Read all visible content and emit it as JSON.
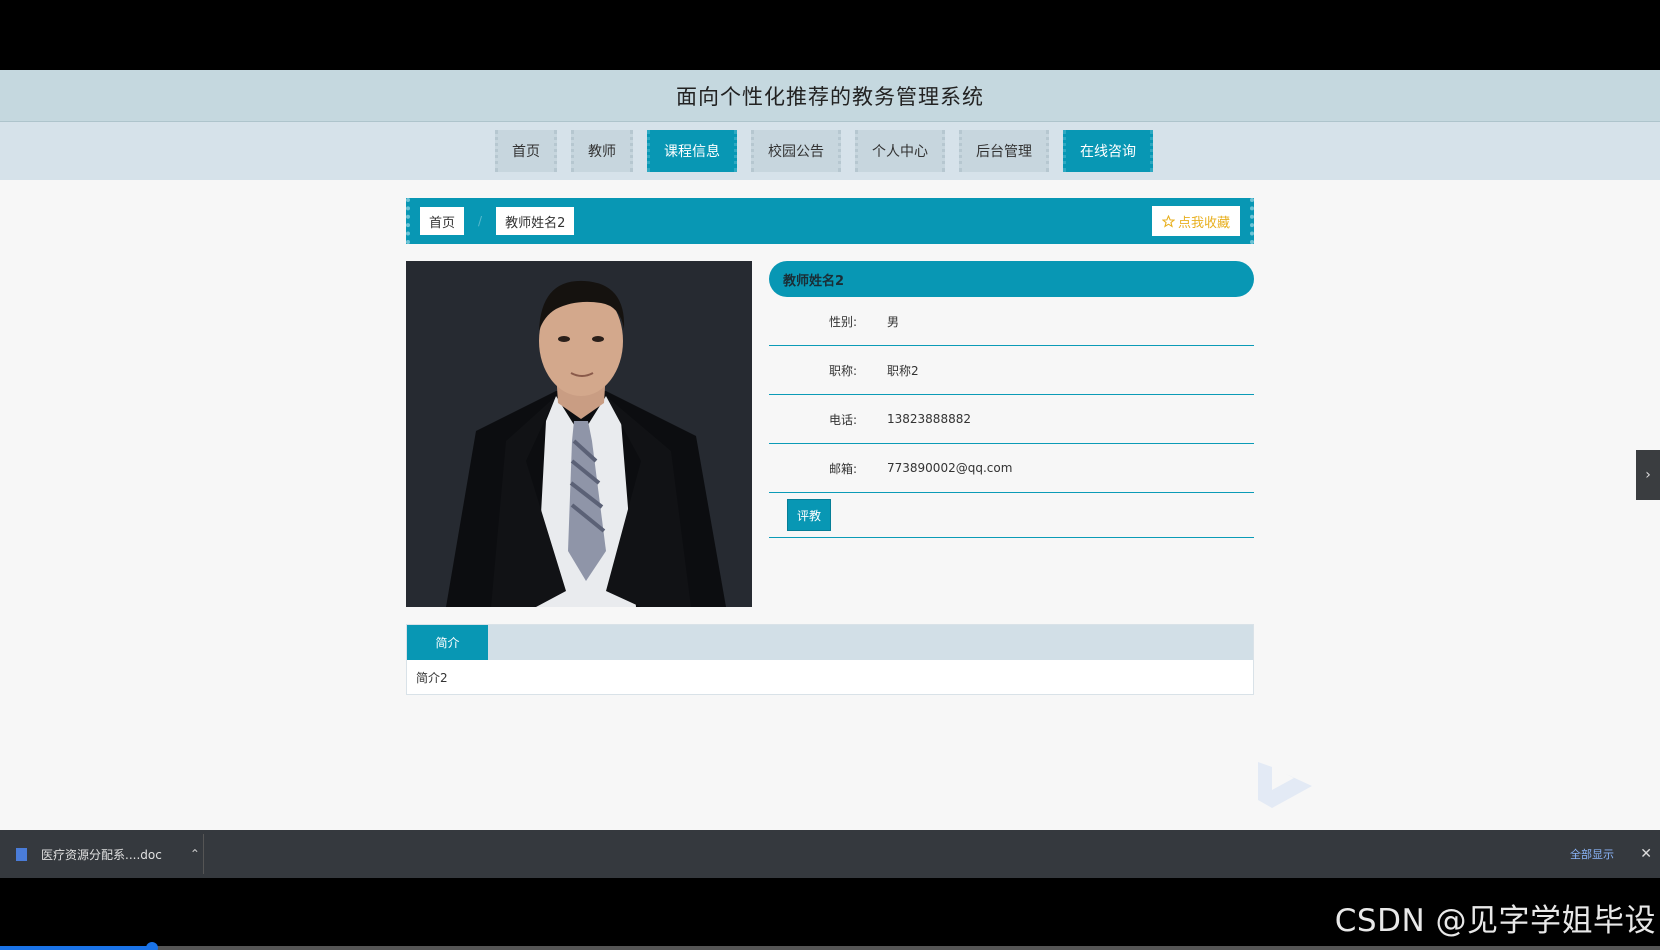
{
  "site": {
    "title": "面向个性化推荐的教务管理系统"
  },
  "nav": {
    "items": [
      {
        "label": "首页",
        "active": false
      },
      {
        "label": "教师",
        "active": false
      },
      {
        "label": "课程信息",
        "active": true
      },
      {
        "label": "校园公告",
        "active": false
      },
      {
        "label": "个人中心",
        "active": false
      },
      {
        "label": "后台管理",
        "active": false
      },
      {
        "label": "在线咨询",
        "active": true
      }
    ]
  },
  "breadcrumb": {
    "home": "首页",
    "separator": "/",
    "current": "教师姓名2",
    "favorite_label": "点我收藏"
  },
  "teacher": {
    "name": "教师姓名2",
    "fields": [
      {
        "label": "性别:",
        "value": "男"
      },
      {
        "label": "职称:",
        "value": "职称2"
      },
      {
        "label": "电话:",
        "value": "13823888882"
      },
      {
        "label": "邮箱:",
        "value": "773890002@qq.com"
      }
    ],
    "review_button": "评教"
  },
  "intro": {
    "tab": "简介",
    "content": "简介2"
  },
  "download_bar": {
    "file_name": "医疗资源分配系....doc",
    "show_all": "全部显示"
  },
  "watermark": "CSDN @见字学姐毕设",
  "colors": {
    "accent": "#0897b4",
    "title_bar": "#c5d8df",
    "nav_bar": "#d6e2ea",
    "favorite": "#e8b020"
  }
}
